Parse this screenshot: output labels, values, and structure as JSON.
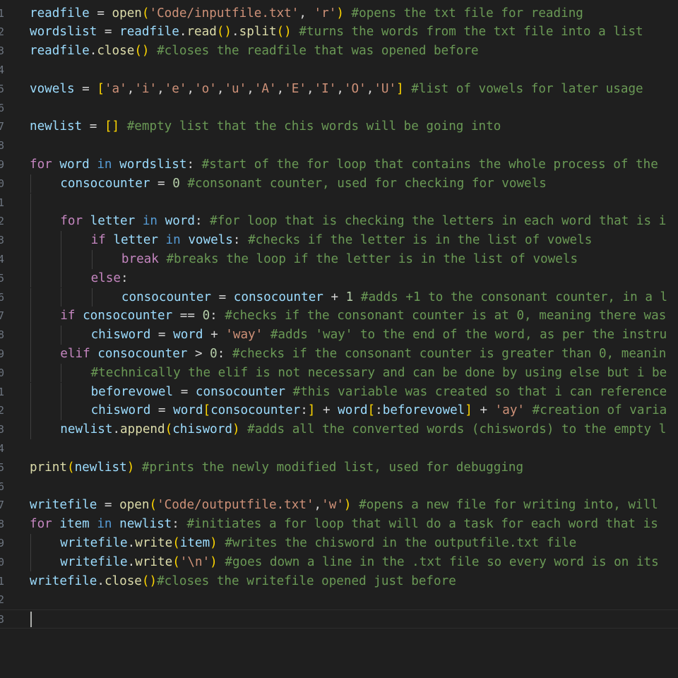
{
  "editor": {
    "language": "python",
    "colors": {
      "background": "#1f1f1f",
      "plain": "#d4d4d4",
      "variable": "#9cdcfe",
      "function": "#dcdcaa",
      "string": "#ce9178",
      "comment": "#6a9955",
      "keyword_control": "#c586c0",
      "keyword": "#569cd6",
      "number": "#b5cea8",
      "bracket_1": "#ffd700",
      "bracket_2": "#da70d6",
      "bracket_3": "#179fff"
    },
    "lines": [
      {
        "n": "1",
        "indent": 0,
        "tokens": [
          [
            "var",
            "readfile"
          ],
          [
            "plain",
            " = "
          ],
          [
            "fn",
            "open"
          ],
          [
            "br1",
            "("
          ],
          [
            "str",
            "'Code/inputfile.txt'"
          ],
          [
            "plain",
            ", "
          ],
          [
            "str",
            "'r'"
          ],
          [
            "br1",
            ")"
          ],
          [
            "plain",
            " "
          ],
          [
            "com",
            "#opens the txt file for reading"
          ]
        ]
      },
      {
        "n": "2",
        "indent": 0,
        "tokens": [
          [
            "var",
            "wordslist"
          ],
          [
            "plain",
            " = "
          ],
          [
            "var",
            "readfile"
          ],
          [
            "plain",
            "."
          ],
          [
            "fn",
            "read"
          ],
          [
            "br1",
            "()"
          ],
          [
            "plain",
            "."
          ],
          [
            "fn",
            "split"
          ],
          [
            "br1",
            "()"
          ],
          [
            "plain",
            " "
          ],
          [
            "com",
            "#turns the words from the txt file into a list"
          ]
        ]
      },
      {
        "n": "3",
        "indent": 0,
        "tokens": [
          [
            "var",
            "readfile"
          ],
          [
            "plain",
            "."
          ],
          [
            "fn",
            "close"
          ],
          [
            "br1",
            "()"
          ],
          [
            "plain",
            " "
          ],
          [
            "com",
            "#closes the readfile that was opened before"
          ]
        ]
      },
      {
        "n": "4",
        "indent": 0,
        "tokens": []
      },
      {
        "n": "5",
        "indent": 0,
        "tokens": [
          [
            "var",
            "vowels"
          ],
          [
            "plain",
            " = "
          ],
          [
            "br1",
            "["
          ],
          [
            "str",
            "'a'"
          ],
          [
            "plain",
            ","
          ],
          [
            "str",
            "'i'"
          ],
          [
            "plain",
            ","
          ],
          [
            "str",
            "'e'"
          ],
          [
            "plain",
            ","
          ],
          [
            "str",
            "'o'"
          ],
          [
            "plain",
            ","
          ],
          [
            "str",
            "'u'"
          ],
          [
            "plain",
            ","
          ],
          [
            "str",
            "'A'"
          ],
          [
            "plain",
            ","
          ],
          [
            "str",
            "'E'"
          ],
          [
            "plain",
            ","
          ],
          [
            "str",
            "'I'"
          ],
          [
            "plain",
            ","
          ],
          [
            "str",
            "'O'"
          ],
          [
            "plain",
            ","
          ],
          [
            "str",
            "'U'"
          ],
          [
            "br1",
            "]"
          ],
          [
            "plain",
            " "
          ],
          [
            "com",
            "#list of vowels for later usage"
          ]
        ]
      },
      {
        "n": "6",
        "indent": 0,
        "tokens": []
      },
      {
        "n": "7",
        "indent": 0,
        "tokens": [
          [
            "var",
            "newlist"
          ],
          [
            "plain",
            " = "
          ],
          [
            "br1",
            "[]"
          ],
          [
            "plain",
            " "
          ],
          [
            "com",
            "#empty list that the chis words will be going into"
          ]
        ]
      },
      {
        "n": "8",
        "indent": 0,
        "tokens": []
      },
      {
        "n": "9",
        "indent": 0,
        "tokens": [
          [
            "kw",
            "for"
          ],
          [
            "plain",
            " "
          ],
          [
            "var",
            "word"
          ],
          [
            "plain",
            " "
          ],
          [
            "kw2",
            "in"
          ],
          [
            "plain",
            " "
          ],
          [
            "var",
            "wordslist"
          ],
          [
            "plain",
            ": "
          ],
          [
            "com",
            "#start of the for loop that contains the whole process of the"
          ]
        ]
      },
      {
        "n": "0",
        "indent": 1,
        "tokens": [
          [
            "var",
            "consocounter"
          ],
          [
            "plain",
            " = "
          ],
          [
            "num",
            "0"
          ],
          [
            "plain",
            " "
          ],
          [
            "com",
            "#consonant counter, used for checking for vowels"
          ]
        ]
      },
      {
        "n": "1",
        "indent": 1,
        "tokens": []
      },
      {
        "n": "2",
        "indent": 1,
        "tokens": [
          [
            "kw",
            "for"
          ],
          [
            "plain",
            " "
          ],
          [
            "var",
            "letter"
          ],
          [
            "plain",
            " "
          ],
          [
            "kw2",
            "in"
          ],
          [
            "plain",
            " "
          ],
          [
            "var",
            "word"
          ],
          [
            "plain",
            ": "
          ],
          [
            "com",
            "#for loop that is checking the letters in each word that is i"
          ]
        ]
      },
      {
        "n": "3",
        "indent": 2,
        "tokens": [
          [
            "kw",
            "if"
          ],
          [
            "plain",
            " "
          ],
          [
            "var",
            "letter"
          ],
          [
            "plain",
            " "
          ],
          [
            "kw2",
            "in"
          ],
          [
            "plain",
            " "
          ],
          [
            "var",
            "vowels"
          ],
          [
            "plain",
            ": "
          ],
          [
            "com",
            "#checks if the letter is in the list of vowels"
          ]
        ]
      },
      {
        "n": "4",
        "indent": 3,
        "tokens": [
          [
            "kw",
            "break"
          ],
          [
            "plain",
            " "
          ],
          [
            "com",
            "#breaks the loop if the letter is in the list of vowels"
          ]
        ]
      },
      {
        "n": "5",
        "indent": 2,
        "tokens": [
          [
            "kw",
            "else"
          ],
          [
            "plain",
            ":"
          ]
        ]
      },
      {
        "n": "6",
        "indent": 3,
        "tokens": [
          [
            "var",
            "consocounter"
          ],
          [
            "plain",
            " = "
          ],
          [
            "var",
            "consocounter"
          ],
          [
            "plain",
            " + "
          ],
          [
            "num",
            "1"
          ],
          [
            "plain",
            " "
          ],
          [
            "com",
            "#adds +1 to the consonant counter, in a l"
          ]
        ]
      },
      {
        "n": "7",
        "indent": 1,
        "tokens": [
          [
            "kw",
            "if"
          ],
          [
            "plain",
            " "
          ],
          [
            "var",
            "consocounter"
          ],
          [
            "plain",
            " == "
          ],
          [
            "num",
            "0"
          ],
          [
            "plain",
            ": "
          ],
          [
            "com",
            "#checks if the consonant counter is at 0, meaning there was"
          ]
        ]
      },
      {
        "n": "8",
        "indent": 2,
        "tokens": [
          [
            "var",
            "chisword"
          ],
          [
            "plain",
            " = "
          ],
          [
            "var",
            "word"
          ],
          [
            "plain",
            " + "
          ],
          [
            "str",
            "'way'"
          ],
          [
            "plain",
            " "
          ],
          [
            "com",
            "#adds 'way' to the end of the word, as per the instru"
          ]
        ]
      },
      {
        "n": "9",
        "indent": 1,
        "tokens": [
          [
            "kw",
            "elif"
          ],
          [
            "plain",
            " "
          ],
          [
            "var",
            "consocounter"
          ],
          [
            "plain",
            " > "
          ],
          [
            "num",
            "0"
          ],
          [
            "plain",
            ": "
          ],
          [
            "com",
            "#checks if the consonant counter is greater than 0, meanin"
          ]
        ]
      },
      {
        "n": "0",
        "indent": 2,
        "tokens": [
          [
            "com",
            "#technically the elif is not necessary and can be done by using else but i be"
          ]
        ]
      },
      {
        "n": "1",
        "indent": 2,
        "tokens": [
          [
            "var",
            "beforevowel"
          ],
          [
            "plain",
            " = "
          ],
          [
            "var",
            "consocounter"
          ],
          [
            "plain",
            " "
          ],
          [
            "com",
            "#this variable was created so that i can reference"
          ]
        ]
      },
      {
        "n": "2",
        "indent": 2,
        "tokens": [
          [
            "var",
            "chisword"
          ],
          [
            "plain",
            " = "
          ],
          [
            "var",
            "word"
          ],
          [
            "br1",
            "["
          ],
          [
            "var",
            "consocounter"
          ],
          [
            "plain",
            ":"
          ],
          [
            "br1",
            "]"
          ],
          [
            "plain",
            " + "
          ],
          [
            "var",
            "word"
          ],
          [
            "br1",
            "["
          ],
          [
            "plain",
            ":"
          ],
          [
            "var",
            "beforevowel"
          ],
          [
            "br1",
            "]"
          ],
          [
            "plain",
            " + "
          ],
          [
            "str",
            "'ay'"
          ],
          [
            "plain",
            " "
          ],
          [
            "com",
            "#creation of varia"
          ]
        ]
      },
      {
        "n": "3",
        "indent": 1,
        "tokens": [
          [
            "var",
            "newlist"
          ],
          [
            "plain",
            "."
          ],
          [
            "fn",
            "append"
          ],
          [
            "br1",
            "("
          ],
          [
            "var",
            "chisword"
          ],
          [
            "br1",
            ")"
          ],
          [
            "plain",
            " "
          ],
          [
            "com",
            "#adds all the converted words (chiswords) to the empty l"
          ]
        ]
      },
      {
        "n": "4",
        "indent": 0,
        "tokens": []
      },
      {
        "n": "5",
        "indent": 0,
        "tokens": [
          [
            "fn",
            "print"
          ],
          [
            "br1",
            "("
          ],
          [
            "var",
            "newlist"
          ],
          [
            "br1",
            ")"
          ],
          [
            "plain",
            " "
          ],
          [
            "com",
            "#prints the newly modified list, used for debugging"
          ]
        ]
      },
      {
        "n": "6",
        "indent": 0,
        "tokens": []
      },
      {
        "n": "7",
        "indent": 0,
        "tokens": [
          [
            "var",
            "writefile"
          ],
          [
            "plain",
            " = "
          ],
          [
            "fn",
            "open"
          ],
          [
            "br1",
            "("
          ],
          [
            "str",
            "'Code/outputfile.txt'"
          ],
          [
            "plain",
            ","
          ],
          [
            "str",
            "'w'"
          ],
          [
            "br1",
            ")"
          ],
          [
            "plain",
            " "
          ],
          [
            "com",
            "#opens a new file for writing into, will"
          ]
        ]
      },
      {
        "n": "8",
        "indent": 0,
        "tokens": [
          [
            "kw",
            "for"
          ],
          [
            "plain",
            " "
          ],
          [
            "var",
            "item"
          ],
          [
            "plain",
            " "
          ],
          [
            "kw2",
            "in"
          ],
          [
            "plain",
            " "
          ],
          [
            "var",
            "newlist"
          ],
          [
            "plain",
            ": "
          ],
          [
            "com",
            "#initiates a for loop that will do a task for each word that is"
          ]
        ]
      },
      {
        "n": "9",
        "indent": 1,
        "tokens": [
          [
            "var",
            "writefile"
          ],
          [
            "plain",
            "."
          ],
          [
            "fn",
            "write"
          ],
          [
            "br1",
            "("
          ],
          [
            "var",
            "item"
          ],
          [
            "br1",
            ")"
          ],
          [
            "plain",
            " "
          ],
          [
            "com",
            "#writes the chisword in the outputfile.txt file"
          ]
        ]
      },
      {
        "n": "0",
        "indent": 1,
        "tokens": [
          [
            "var",
            "writefile"
          ],
          [
            "plain",
            "."
          ],
          [
            "fn",
            "write"
          ],
          [
            "br1",
            "("
          ],
          [
            "str",
            "'\\n'"
          ],
          [
            "br1",
            ")"
          ],
          [
            "plain",
            " "
          ],
          [
            "com",
            "#goes down a line in the .txt file so every word is on its"
          ]
        ]
      },
      {
        "n": "1",
        "indent": 0,
        "tokens": [
          [
            "var",
            "writefile"
          ],
          [
            "plain",
            "."
          ],
          [
            "fn",
            "close"
          ],
          [
            "br1",
            "()"
          ],
          [
            "com",
            "#closes the writefile opened just before"
          ]
        ]
      },
      {
        "n": "2",
        "indent": 0,
        "tokens": []
      },
      {
        "n": "3",
        "indent": 0,
        "tokens": [],
        "cursor": true
      }
    ]
  }
}
